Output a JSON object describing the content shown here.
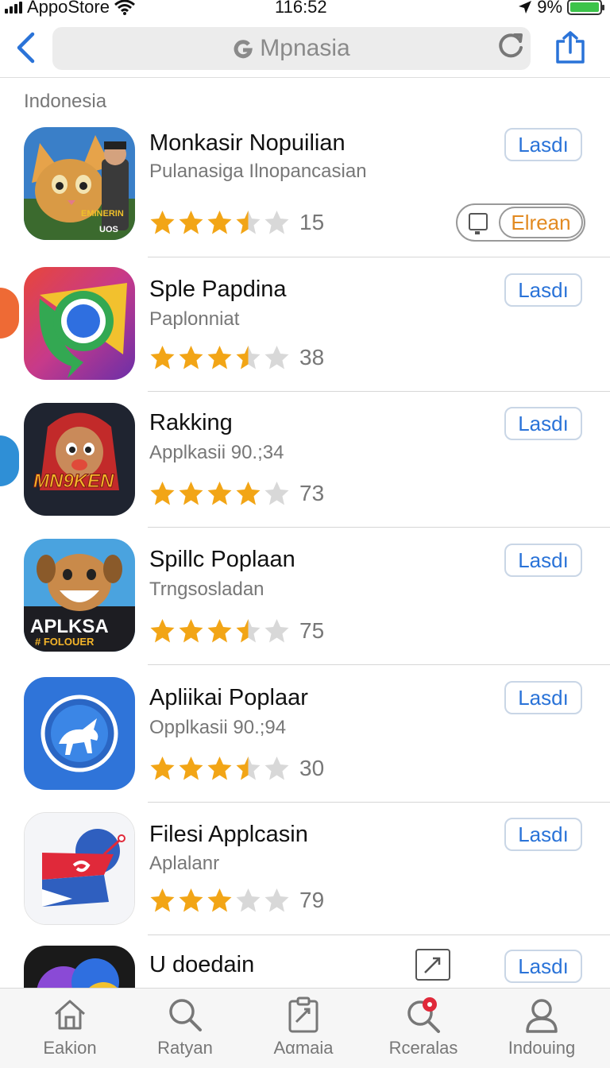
{
  "status_bar": {
    "carrier": "AppoStore",
    "time": "116:52",
    "battery": "9%"
  },
  "search": {
    "text": "Mpnasia"
  },
  "section_title": "Indonesia",
  "apps": [
    {
      "name": "Monkasir Nopuilian",
      "subtitle": "Pulanasiga Ilnoрancasian",
      "rating": 3.5,
      "count": "15",
      "button": "Lasdı",
      "icon": "cat-cartoon-icon"
    },
    {
      "name": "Sple Papdina",
      "subtitle": "Paplonniat",
      "rating": 3.5,
      "count": "38",
      "button": "Lasdı",
      "icon": "chrome-like-icon"
    },
    {
      "name": "Rakking",
      "subtitle": "Applkasii 90.;34",
      "rating": 4.0,
      "count": "73",
      "button": "Lasdı",
      "icon": "monkey-game-icon",
      "icon_text": "MN9KEN"
    },
    {
      "name": "Spillc Poplaan",
      "subtitle": "Trngsosladan",
      "rating": 3.5,
      "count": "75",
      "button": "Lasdı",
      "icon": "dog-cartoon-icon",
      "icon_text": "APLKSA",
      "icon_text2": "# FOLOUER"
    },
    {
      "name": "Apliikai Poplaar",
      "subtitle": "Opplkasii 90.;94",
      "rating": 3.5,
      "count": "30",
      "button": "Lasdı",
      "icon": "compass-dog-icon"
    },
    {
      "name": "Filesi Applcasin",
      "subtitle": "Aplalanr",
      "rating": 3.0,
      "count": "79",
      "button": "Lasdı",
      "icon": "flag-document-icon"
    },
    {
      "name": "U doedain",
      "subtitle": "",
      "button": "Lasdı",
      "icon": "colorful-logo-icon"
    }
  ],
  "toggle": {
    "label": "Elrean"
  },
  "tabs": [
    {
      "label": "Eakion",
      "icon": "home-icon"
    },
    {
      "label": "Ratyan",
      "icon": "search-icon"
    },
    {
      "label": "Aαmaia",
      "icon": "clipboard-icon"
    },
    {
      "label": "Rceralas",
      "icon": "notification-search-icon"
    },
    {
      "label": "Indouing",
      "icon": "person-icon"
    }
  ],
  "colors": {
    "accent": "#2a73d8",
    "star": "#f2a516",
    "star_empty": "#d8d8d8",
    "toggle_text": "#e28a21",
    "badge": "#e0293a"
  }
}
